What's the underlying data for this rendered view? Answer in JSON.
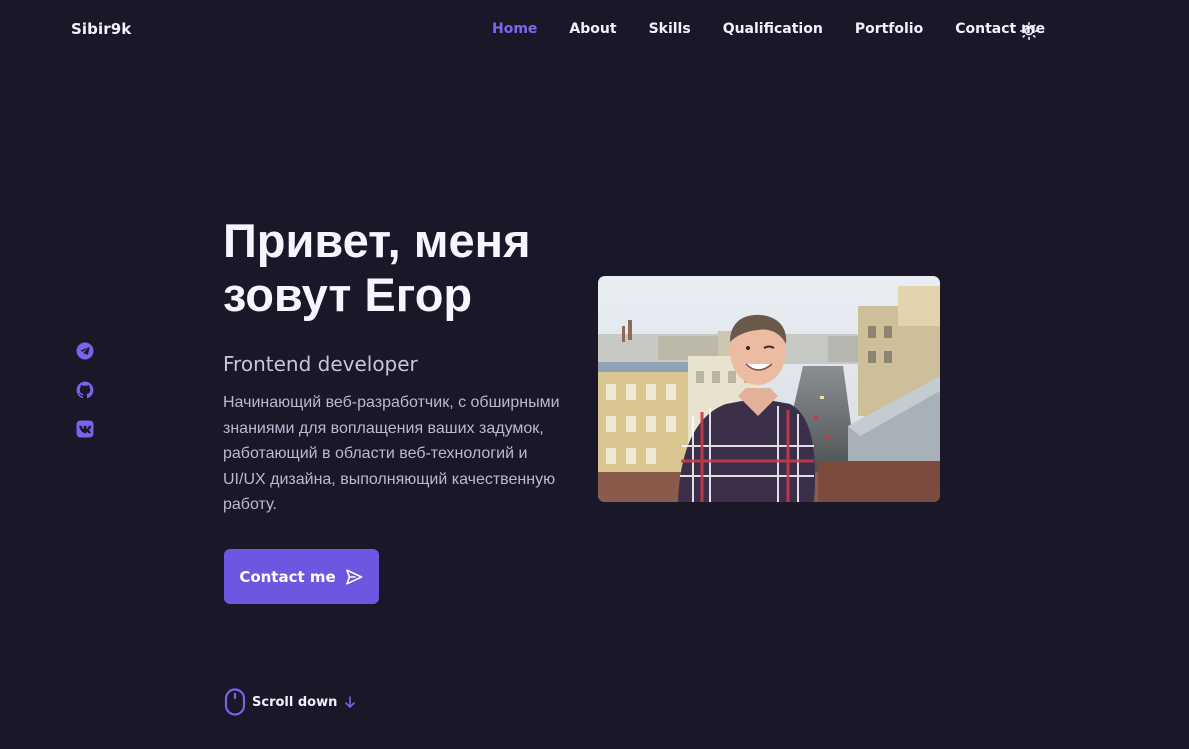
{
  "brand": {
    "logo": "Sibir9k",
    "accent_color": "#6e56e0",
    "active_color": "#7d67f0",
    "background": "#1a1728"
  },
  "nav": {
    "items": [
      {
        "label": "Home",
        "active": true
      },
      {
        "label": "About",
        "active": false
      },
      {
        "label": "Skills",
        "active": false
      },
      {
        "label": "Qualification",
        "active": false
      },
      {
        "label": "Portfolio",
        "active": false
      },
      {
        "label": "Contact me",
        "active": false
      }
    ],
    "theme_icon": "sun-icon"
  },
  "social": {
    "items": [
      {
        "icon": "telegram-icon"
      },
      {
        "icon": "github-icon"
      },
      {
        "icon": "vk-icon"
      }
    ]
  },
  "hero": {
    "title_line1": "Привет, меня",
    "title_line2": "зовут Егор",
    "subtitle": "Frontend developer",
    "description": "Начинающий веб-разработчик, с обширными знаниями для воплащения ваших задумок, работающий в области веб-технологий и UI/UX дизайна, выполняющий качественную работу.",
    "cta_label": "Contact me",
    "cta_icon": "send-icon",
    "photo_icon": "profile-photo"
  },
  "scroll": {
    "label": "Scroll down",
    "mouse_icon": "mouse-icon",
    "arrow_icon": "arrow-down-icon"
  }
}
